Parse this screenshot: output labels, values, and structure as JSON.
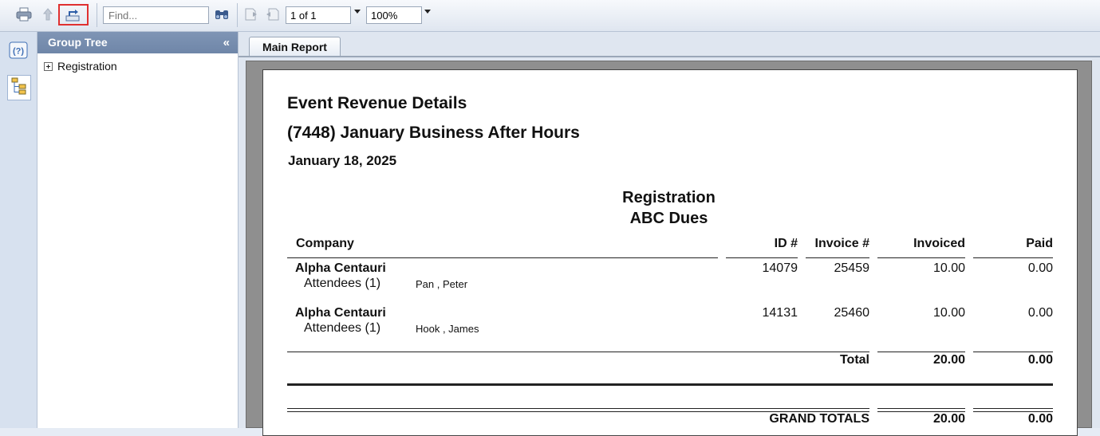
{
  "toolbar": {
    "find_placeholder": "Find...",
    "page_value": "1 of 1",
    "zoom_value": "100%",
    "icons": [
      "print-icon",
      "up-arrow-icon",
      "export-icon",
      "binoculars-icon",
      "first-page-icon",
      "previous-page-icon"
    ],
    "highlight_color": "#e03030"
  },
  "sidebar": {
    "group_tree_label": "Group Tree",
    "collapse_label": "«",
    "items": [
      {
        "label": "Registration"
      }
    ]
  },
  "tabs": [
    {
      "label": "Main Report"
    }
  ],
  "report": {
    "title": "Event Revenue Details",
    "event": "(7448) January Business After Hours",
    "date": "January 18, 2025",
    "group": "Registration",
    "subgroup": "ABC Dues",
    "columns": {
      "company": "Company",
      "id": "ID #",
      "invoice": "Invoice #",
      "invoiced": "Invoiced",
      "paid": "Paid"
    },
    "rows": [
      {
        "company": "Alpha Centauri",
        "attendees": "Attendees (1)",
        "attendee_name": "Pan , Peter",
        "id": "14079",
        "invoice": "25459",
        "invoiced": "10.00",
        "paid": "0.00"
      },
      {
        "company": "Alpha Centauri",
        "attendees": "Attendees (1)",
        "attendee_name": "Hook , James",
        "id": "14131",
        "invoice": "25460",
        "invoiced": "10.00",
        "paid": "0.00"
      }
    ],
    "total": {
      "label": "Total",
      "invoiced": "20.00",
      "paid": "0.00"
    },
    "grand_total": {
      "label": "GRAND TOTALS",
      "invoiced": "20.00",
      "paid": "0.00"
    }
  }
}
